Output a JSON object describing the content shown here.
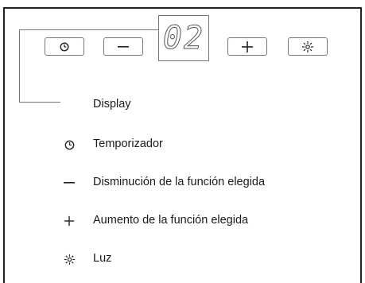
{
  "panel": {
    "display_value": "02",
    "buttons": [
      {
        "id": "timer",
        "icon": "clock-icon"
      },
      {
        "id": "minus",
        "icon": "minus-icon"
      },
      {
        "id": "plus",
        "icon": "plus-icon"
      },
      {
        "id": "light",
        "icon": "light-icon"
      }
    ]
  },
  "legend": {
    "display": "Display",
    "timer": "Temporizador",
    "minus": "Disminución de la función elegida",
    "plus": "Aumento de la función elegida",
    "light": "Luz"
  }
}
